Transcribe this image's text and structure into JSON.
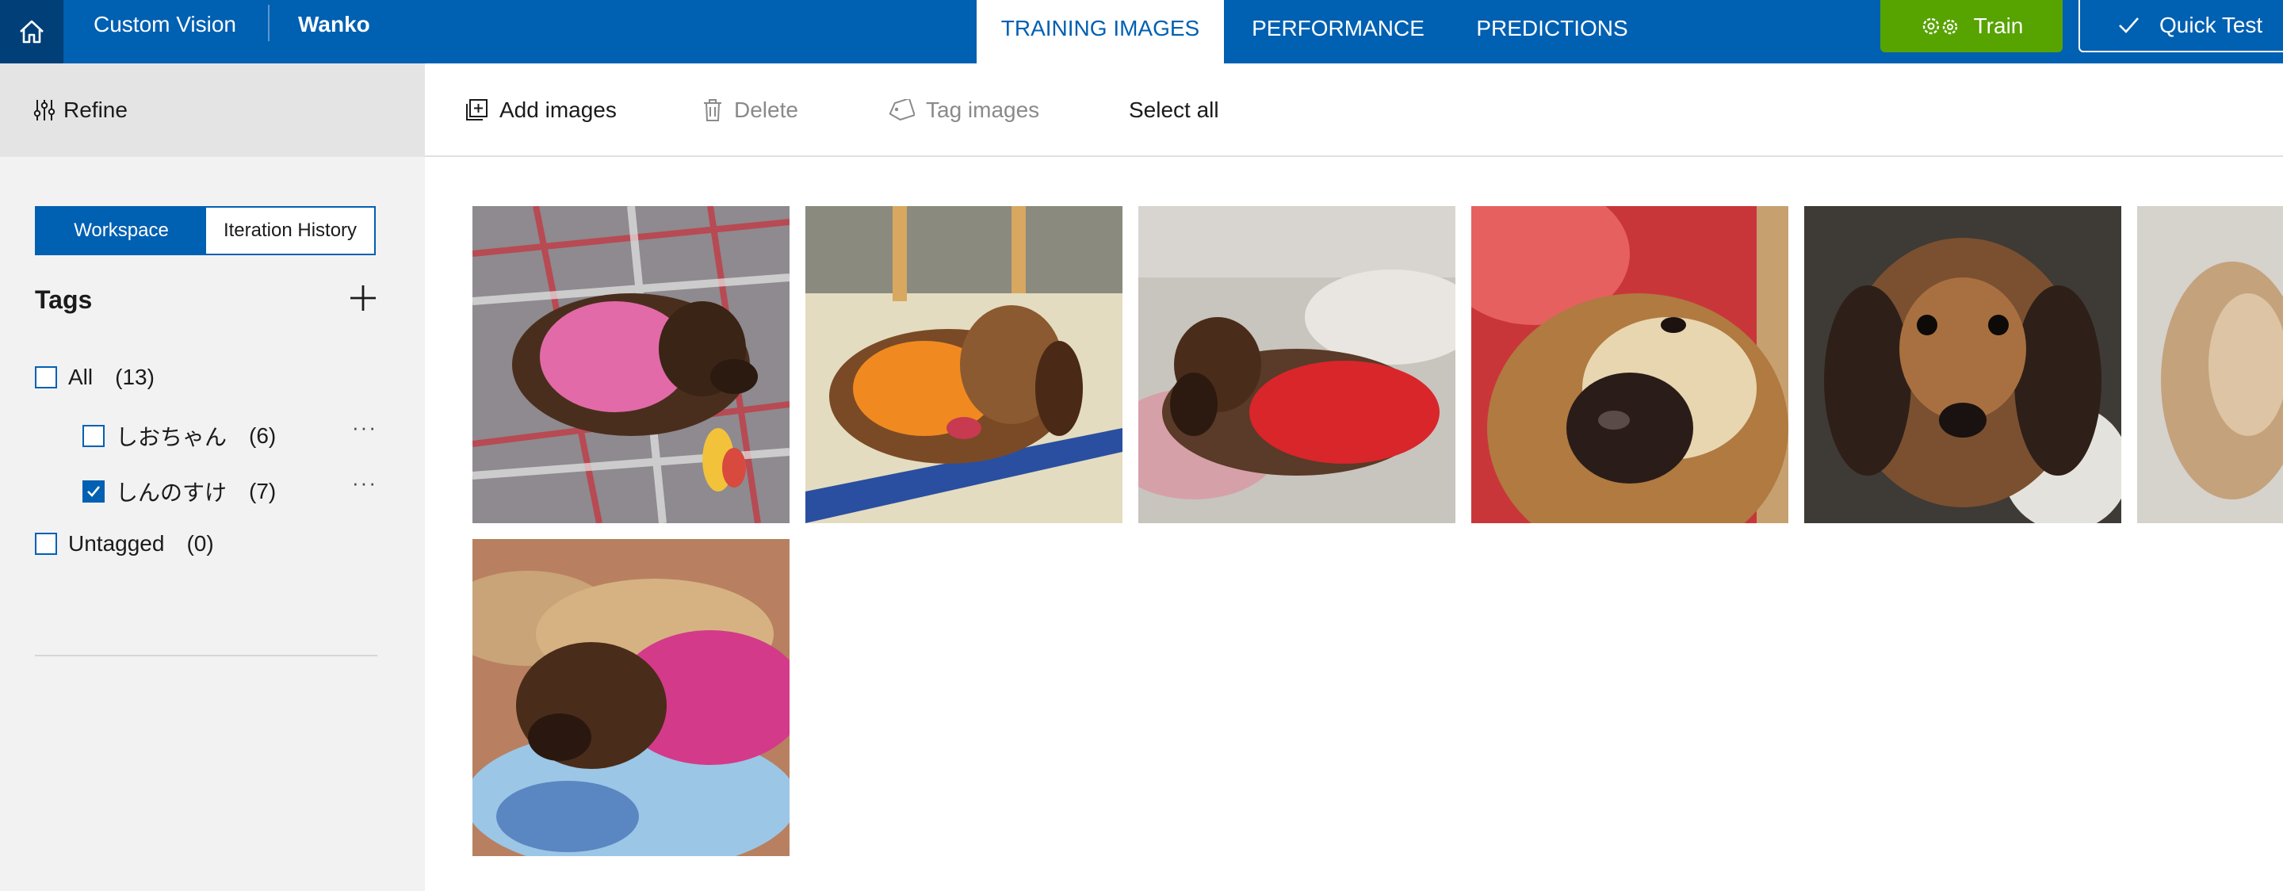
{
  "header": {
    "home_icon": "home-icon",
    "app_name": "Custom Vision",
    "project_name": "Wanko",
    "tabs": [
      {
        "label": "TRAINING IMAGES",
        "active": true
      },
      {
        "label": "PERFORMANCE",
        "active": false
      },
      {
        "label": "PREDICTIONS",
        "active": false
      }
    ],
    "train_label": "Train",
    "train_icon": "gears-icon",
    "quick_test_label": "Quick Test",
    "quick_test_icon": "checkmark-icon"
  },
  "sidebar": {
    "refine_label": "Refine",
    "refine_icon": "sliders-icon",
    "segmented": [
      {
        "label": "Workspace",
        "active": true
      },
      {
        "label": "Iteration History",
        "active": false
      }
    ],
    "tags_title": "Tags",
    "tags": [
      {
        "label": "All",
        "count": "(13)",
        "checked": false
      },
      {
        "label": "しおちゃん",
        "count": "(6)",
        "checked": false,
        "more": "···"
      },
      {
        "label": "しんのすけ",
        "count": "(7)",
        "checked": true,
        "more": "···"
      },
      {
        "label": "Untagged",
        "count": "(0)",
        "checked": false
      }
    ]
  },
  "toolbar": {
    "add_images": "Add images",
    "delete": "Delete",
    "tag_images": "Tag images",
    "select_all": "Select all"
  },
  "gallery": {
    "images": [
      "dachshund in pink sweater lying on plaid blanket with toy",
      "dachshund in orange shirt lying on tatami mat",
      "dachshund in red shirt lying on bedding",
      "close-up of dachshund nose",
      "close-up of dachshund face",
      "partially visible blurred dog photo",
      "dachshund in pink sweater lying on blue blanket"
    ]
  },
  "colors": {
    "brand_blue": "#0060b2",
    "home_blue": "#003f78",
    "train_green": "#57a300",
    "sidebar_bg": "#f2f2f2"
  }
}
